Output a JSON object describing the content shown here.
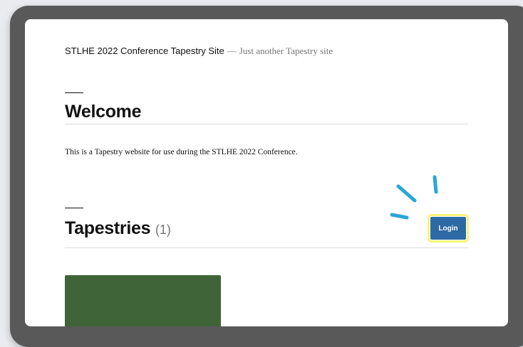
{
  "site": {
    "title": "STLHE 2022 Conference Tapestry Site",
    "separator": "—",
    "description": "Just another Tapestry site"
  },
  "welcome": {
    "heading": "Welcome",
    "intro": "This is a Tapestry website for use during the STLHE 2022 Conference."
  },
  "tapestries": {
    "heading": "Tapestries",
    "count": "(1)",
    "card_color": "#3f6438"
  },
  "login": {
    "label": "Login",
    "color": "#2d6aa4",
    "highlight_color": "#f6f57a",
    "burst_color": "#2aa6d6",
    "burst_icon": "attention-burst-icon"
  }
}
